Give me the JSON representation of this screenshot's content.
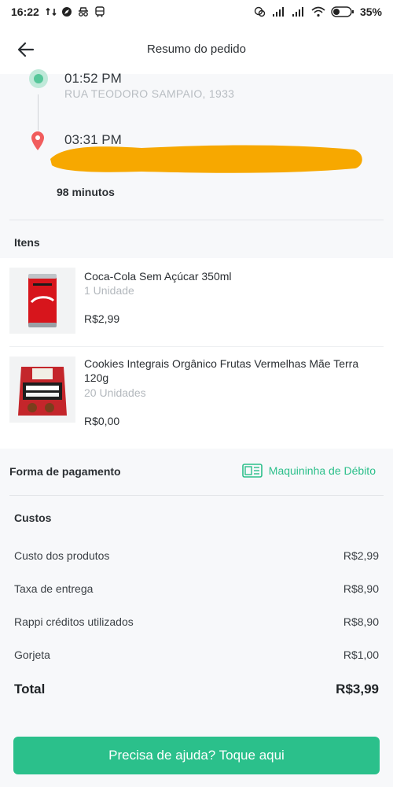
{
  "status_bar": {
    "time": "16:22",
    "battery_percent": "35%",
    "battery_level": 0.35,
    "left_icons": [
      "signal-arrows-icon",
      "compass-icon",
      "incognito-icon",
      "bus-icon"
    ],
    "right_icons": [
      "vibrate-icon",
      "cell-signal-icon",
      "cell-signal-icon",
      "wifi-icon",
      "battery-icon"
    ]
  },
  "header": {
    "title": "Resumo do pedido",
    "back_icon": "arrow-left-icon"
  },
  "route": {
    "pickup_time": "01:52 PM",
    "pickup_address": "RUA TEODORO SAMPAIO, 1933",
    "dropoff_time": "03:31 PM",
    "dropoff_address": "R...",
    "duration": "98 minutos",
    "pickup_color": "#56c79a",
    "dropoff_color": "#f15d5d",
    "redaction_color": "#f7a800"
  },
  "items": {
    "heading": "Itens",
    "list": [
      {
        "name": "Coca-Cola Sem Açúcar  350ml",
        "quantity": "1 Unidade",
        "price": "R$2,99",
        "image_icon": "soda-can-icon"
      },
      {
        "name": "Cookies Integrais Orgânico Frutas Vermelhas Mãe Terra 120g",
        "quantity": "20 Unidades",
        "price": "R$0,00",
        "image_icon": "cookie-package-icon"
      }
    ]
  },
  "payment": {
    "label": "Forma de pagamento",
    "method": "Maquininha de Débito",
    "method_icon": "card-machine-icon",
    "accent_color": "#2bbf8a"
  },
  "costs": {
    "heading": "Custos",
    "rows": [
      {
        "label": "Custo dos produtos",
        "value": "R$2,99"
      },
      {
        "label": "Taxa de entrega",
        "value": "R$8,90"
      },
      {
        "label": "Rappi créditos utilizados",
        "value": "R$8,90"
      },
      {
        "label": "Gorjeta",
        "value": "R$1,00"
      }
    ],
    "total_label": "Total",
    "total_value": "R$3,99"
  },
  "help_button": {
    "label": "Precisa de ajuda? Toque aqui",
    "color": "#2bc08b"
  }
}
